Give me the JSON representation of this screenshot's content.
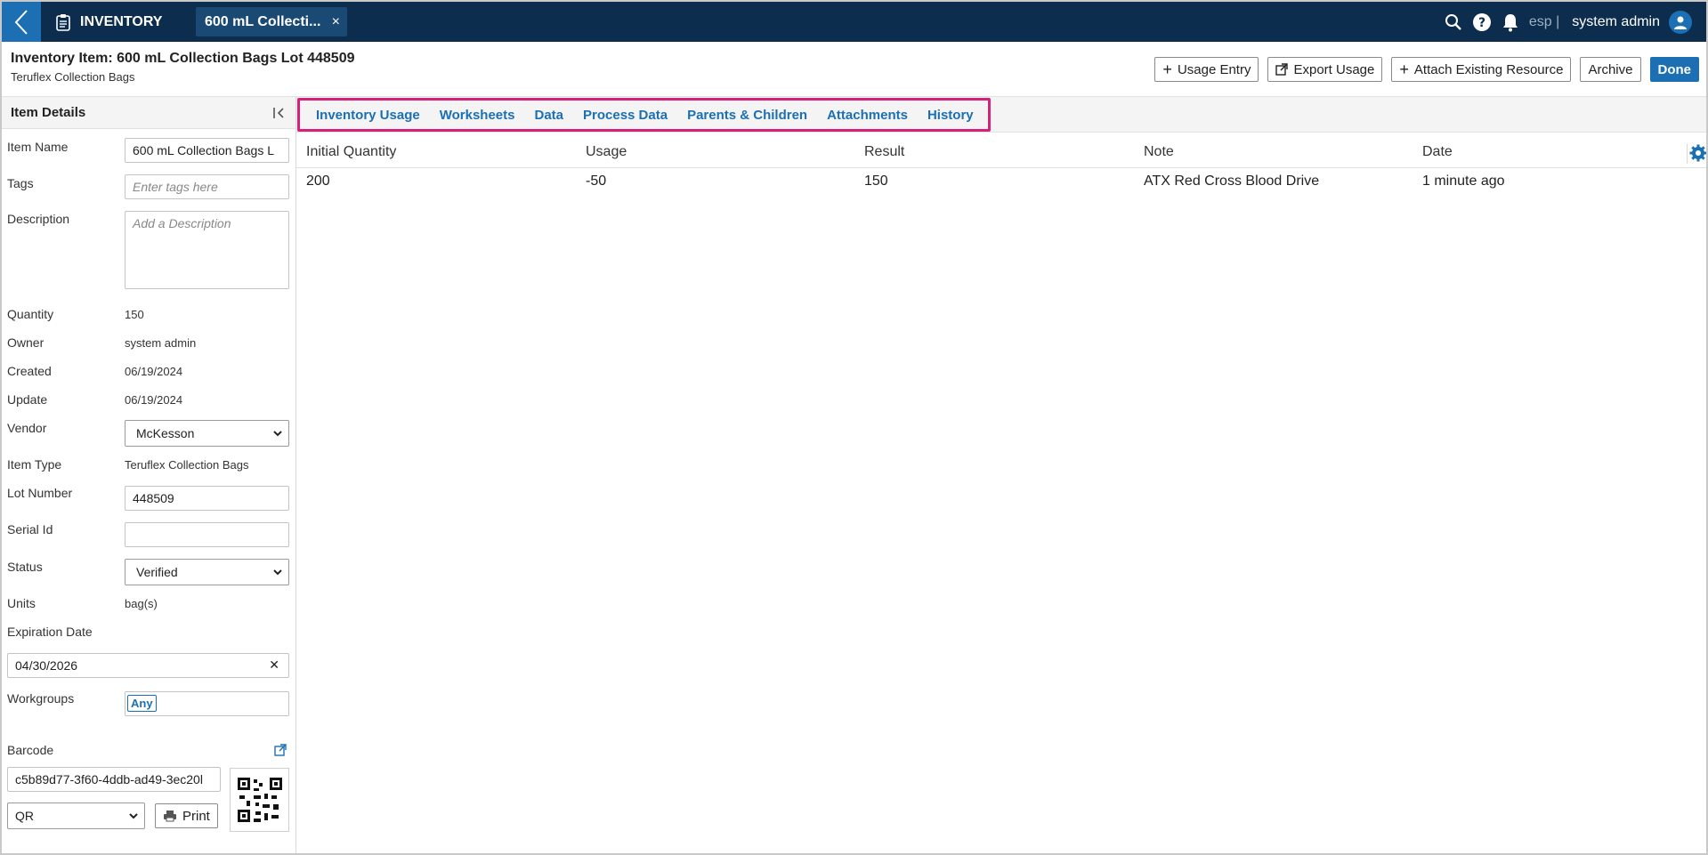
{
  "topbar": {
    "app_name": "INVENTORY",
    "doc_tab_label": "600 mL Collecti...",
    "doc_tab_close": "×",
    "lang": "esp |",
    "user_name": "system admin"
  },
  "header": {
    "title": "Inventory Item: 600 mL Collection Bags Lot 448509",
    "subtitle": "Teruflex Collection Bags",
    "buttons": {
      "usage_entry": "Usage Entry",
      "export_usage": "Export Usage",
      "attach_resource": "Attach Existing Resource",
      "archive": "Archive",
      "done": "Done"
    }
  },
  "left_panel": {
    "title": "Item Details",
    "fields": {
      "item_name_label": "Item Name",
      "item_name_value": "600 mL Collection Bags L",
      "tags_label": "Tags",
      "tags_placeholder": "Enter tags here",
      "description_label": "Description",
      "description_placeholder": "Add a Description",
      "quantity_label": "Quantity",
      "quantity_value": "150",
      "owner_label": "Owner",
      "owner_value": "system admin",
      "created_label": "Created",
      "created_value": "06/19/2024",
      "update_label": "Update",
      "update_value": "06/19/2024",
      "vendor_label": "Vendor",
      "vendor_value": "McKesson",
      "item_type_label": "Item Type",
      "item_type_value": "Teruflex Collection Bags",
      "lot_number_label": "Lot Number",
      "lot_number_value": "448509",
      "serial_id_label": "Serial Id",
      "serial_id_value": "",
      "status_label": "Status",
      "status_value": "Verified",
      "units_label": "Units",
      "units_value": "bag(s)",
      "expiration_label": "Expiration Date",
      "expiration_value": "04/30/2026",
      "workgroups_label": "Workgroups",
      "workgroups_chip": "Any",
      "barcode_label": "Barcode",
      "barcode_value": "c5b89d77-3f60-4ddb-ad49-3ec20l",
      "barcode_type": "QR",
      "print_label": "Print"
    }
  },
  "tabs": [
    "Inventory Usage",
    "Worksheets",
    "Data",
    "Process Data",
    "Parents & Children",
    "Attachments",
    "History"
  ],
  "table": {
    "headers": [
      "Initial Quantity",
      "Usage",
      "Result",
      "Note",
      "Date"
    ],
    "rows": [
      [
        "200",
        "-50",
        "150",
        "ATX Red Cross Blood Drive",
        "1 minute ago"
      ]
    ]
  },
  "colors": {
    "topbar": "#0c2d4d",
    "accent": "#1c6fb3",
    "highlight_box": "#d6217a"
  }
}
